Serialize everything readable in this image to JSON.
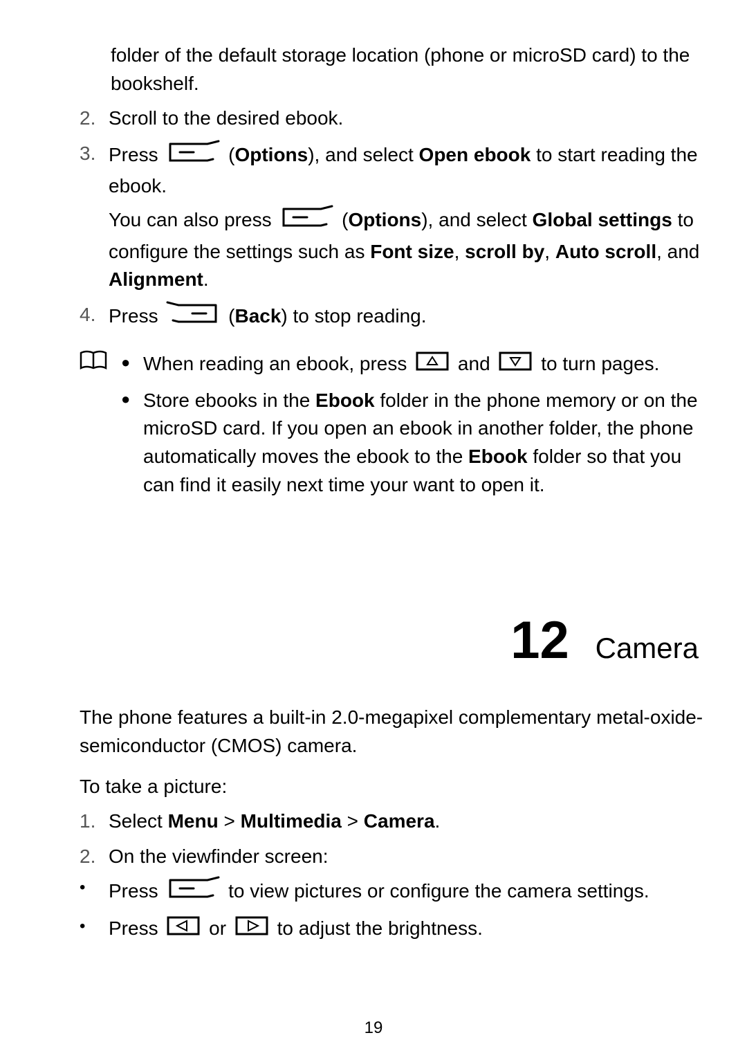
{
  "step1_cont": "folder of the default storage location (phone or microSD card) to the bookshelf.",
  "step2_num": "2.",
  "step2_txt": "Scroll to the desired ebook.",
  "step3_num": "3.",
  "step3_a": "Press ",
  "step3_b": " (",
  "step3_options": "Options",
  "step3_c": "), and select ",
  "step3_open": "Open ebook",
  "step3_d": " to start reading the ebook.",
  "step3_sub_a": "You can also press ",
  "step3_sub_b": " (",
  "step3_sub_options": "Options",
  "step3_sub_c": "), and select ",
  "step3_sub_global": "Global settings",
  "step3_sub_d": " to configure the settings such as ",
  "step3_sub_font": "Font size",
  "step3_sub_e": ", ",
  "step3_sub_scroll": "scroll by",
  "step3_sub_f": ", ",
  "step3_sub_auto": "Auto scroll",
  "step3_sub_g": ", and ",
  "step3_sub_align": "Alignment",
  "step3_sub_h": ".",
  "step4_num": "4.",
  "step4_a": "Press ",
  "step4_b": " (",
  "step4_back": "Back",
  "step4_c": ") to stop reading.",
  "note1_a": "When reading an ebook, press ",
  "note1_b": " and ",
  "note1_c": " to turn pages.",
  "note2_a": "Store ebooks in the ",
  "note2_ebook": "Ebook",
  "note2_b": " folder in the phone memory or on the microSD card. If you open an ebook in another folder, the phone automatically moves the ebook to the ",
  "note2_ebook2": "Ebook",
  "note2_c": " folder so that you can find it easily next time your want to open it.",
  "chapnum": "12",
  "chaptitle": "Camera",
  "camera_p1": "The phone features a built-in 2.0-megapixel complementary metal-oxide-semiconductor (CMOS) camera.",
  "camera_p2": "To take a picture:",
  "cam_s1_num": "1.",
  "cam_s1_a": "Select ",
  "cam_s1_menu": "Menu",
  "cam_s1_gt1": " > ",
  "cam_s1_mm": "Multimedia",
  "cam_s1_gt2": " > ",
  "cam_s1_cam": "Camera",
  "cam_s1_dot": ".",
  "cam_s2_num": "2.",
  "cam_s2_txt": "On the viewfinder screen:",
  "cam_b1_a": "Press ",
  "cam_b1_b": " to view pictures or configure the camera settings.",
  "cam_b2_a": "Press ",
  "cam_b2_b": " or ",
  "cam_b2_c": " to adjust the brightness.",
  "pagenum": "19"
}
